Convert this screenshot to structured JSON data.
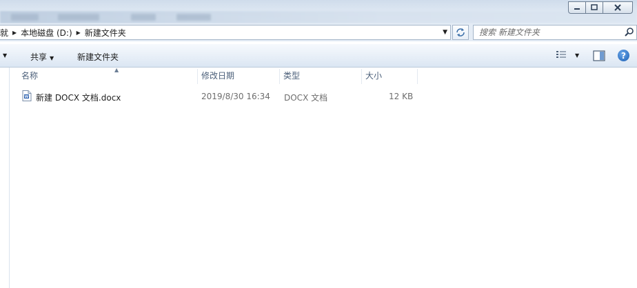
{
  "window": {
    "minimize_glyph": "—",
    "maximize_glyph": "□",
    "close_glyph": "✕"
  },
  "address": {
    "crumbs": [
      "就",
      "本地磁盘 (D:)",
      "新建文件夹"
    ],
    "search_placeholder": "搜索 新建文件夹"
  },
  "toolbar": {
    "share_label": "共享",
    "new_folder_label": "新建文件夹",
    "help_glyph": "?"
  },
  "columns": {
    "name": "名称",
    "date": "修改日期",
    "type": "类型",
    "size": "大小"
  },
  "files": [
    {
      "name": "新建 DOCX 文档.docx",
      "date": "2019/8/30 16:34",
      "type": "DOCX 文档",
      "size": "12 KB",
      "icon": "word-document-icon"
    }
  ],
  "colors": {
    "accent": "#1c5fb3",
    "header_text": "#4c607a",
    "muted_text": "#6d6d6d"
  }
}
